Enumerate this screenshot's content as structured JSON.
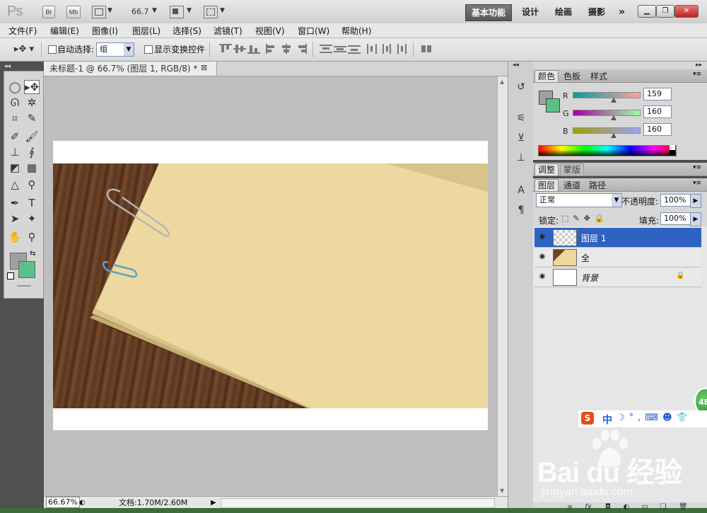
{
  "app": {
    "logo": "Ps",
    "bridge_label": "Br",
    "minibridge_label": "Mb",
    "zoom": "66.7",
    "workspaces": [
      "基本功能",
      "设计",
      "绘画",
      "摄影"
    ],
    "more": "»"
  },
  "menu": [
    "文件(F)",
    "编辑(E)",
    "图像(I)",
    "图层(L)",
    "选择(S)",
    "滤镜(T)",
    "视图(V)",
    "窗口(W)",
    "帮助(H)"
  ],
  "options": {
    "auto_select_label": "自动选择:",
    "auto_select_value": "组",
    "show_transform_label": "显示变换控件"
  },
  "document": {
    "tab_title": "未标题-1 @ 66.7% (图层 1, RGB/8) *",
    "close": "⊠"
  },
  "status": {
    "zoom": "66.67%",
    "doc_size": "文档:1.70M/2.60M"
  },
  "color_panel": {
    "tabs": [
      "颜色",
      "色板",
      "样式"
    ],
    "r_label": "R",
    "g_label": "G",
    "b_label": "B",
    "r": "159",
    "g": "160",
    "b": "160",
    "fg_color": "#9fa0a0",
    "bg_color": "#5cbf85"
  },
  "adjust_panel": {
    "tabs": [
      "调整",
      "蒙版"
    ]
  },
  "layers_panel": {
    "tabs": [
      "图层",
      "通道",
      "路径"
    ],
    "blend_mode": "正常",
    "opacity_label": "不透明度:",
    "opacity": "100%",
    "lock_label": "锁定:",
    "fill_label": "填充:",
    "fill": "100%",
    "layers": [
      {
        "name": "图层 1",
        "selected": true
      },
      {
        "name": "全",
        "selected": false
      },
      {
        "name": "背景",
        "selected": false,
        "locked": true
      }
    ]
  },
  "overlays": {
    "badge": "48",
    "ime_s": "S",
    "ime_mode": "中",
    "watermark_main": "Bai du 经验",
    "watermark_url": "jingyan.baidu.com"
  }
}
